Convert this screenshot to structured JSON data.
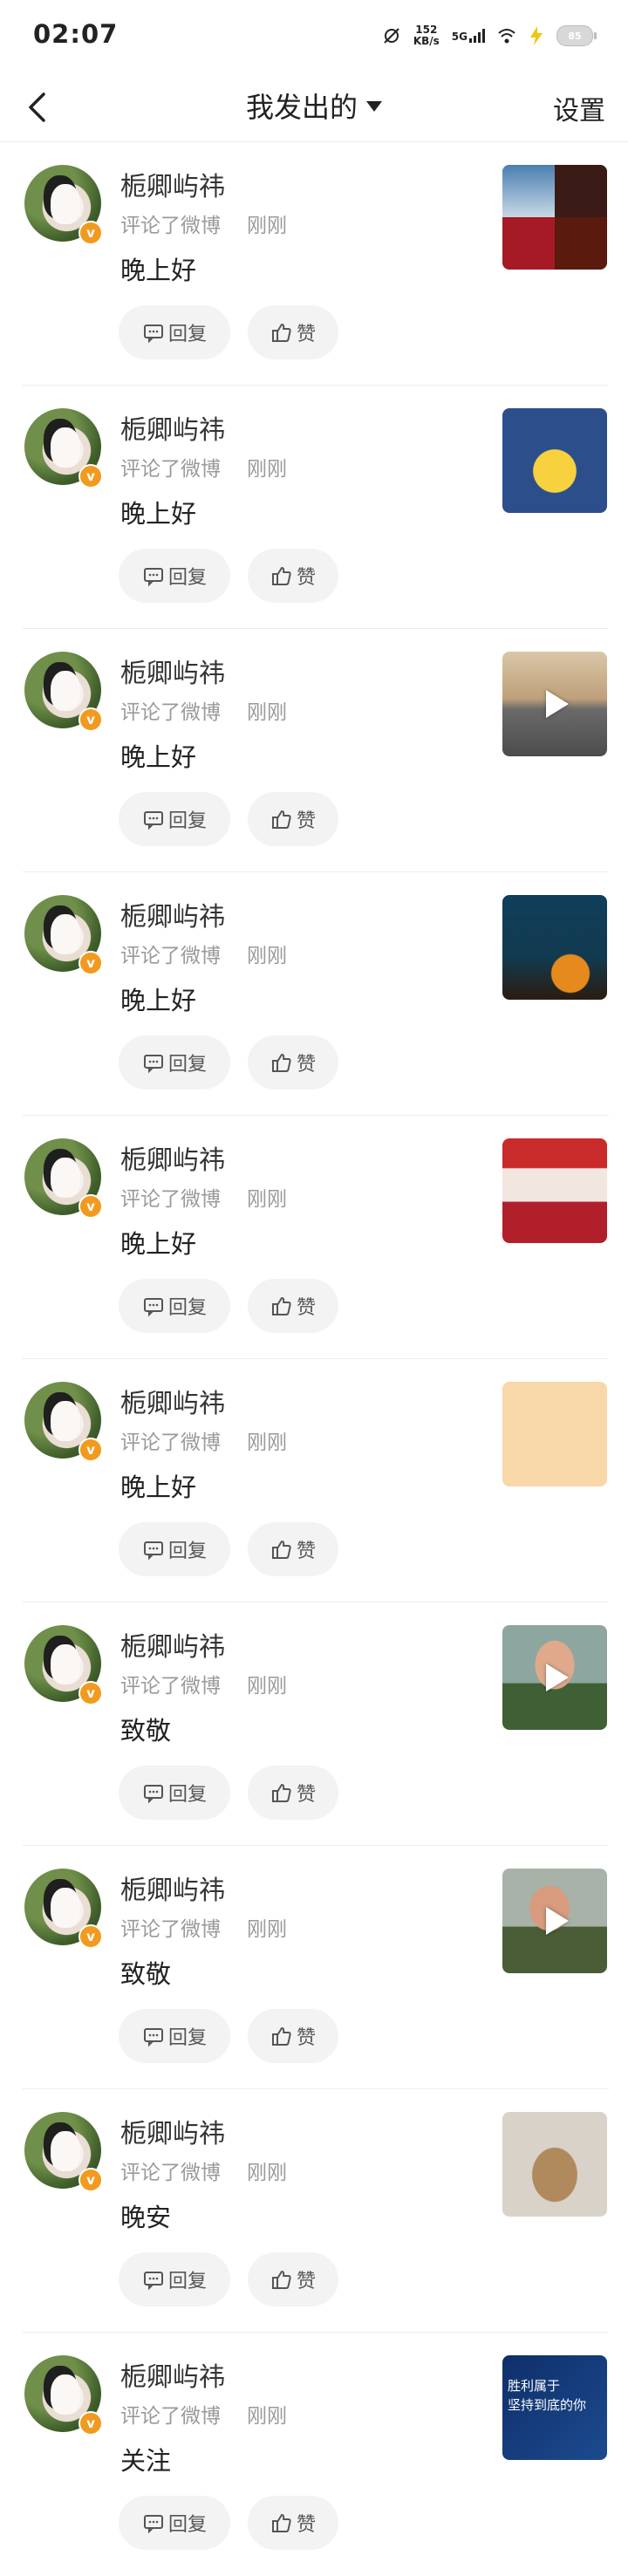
{
  "status_bar": {
    "time": "02:07",
    "speed_value": "152",
    "speed_unit": "KB/s",
    "network": "5G",
    "battery": "85"
  },
  "nav": {
    "title": "我发出的",
    "settings_label": "设置"
  },
  "feed": {
    "items": [
      {
        "username": "栀卿屿祎",
        "action": "评论了微博",
        "time": "刚刚",
        "content": "晚上好",
        "reply_label": "回复",
        "like_label": "赞"
      },
      {
        "username": "栀卿屿祎",
        "action": "评论了微博",
        "time": "刚刚",
        "content": "晚上好",
        "reply_label": "回复",
        "like_label": "赞"
      },
      {
        "username": "栀卿屿祎",
        "action": "评论了微博",
        "time": "刚刚",
        "content": "晚上好",
        "reply_label": "回复",
        "like_label": "赞"
      },
      {
        "username": "栀卿屿祎",
        "action": "评论了微博",
        "time": "刚刚",
        "content": "晚上好",
        "reply_label": "回复",
        "like_label": "赞"
      },
      {
        "username": "栀卿屿祎",
        "action": "评论了微博",
        "time": "刚刚",
        "content": "晚上好",
        "reply_label": "回复",
        "like_label": "赞"
      },
      {
        "username": "栀卿屿祎",
        "action": "评论了微博",
        "time": "刚刚",
        "content": "晚上好",
        "reply_label": "回复",
        "like_label": "赞"
      },
      {
        "username": "栀卿屿祎",
        "action": "评论了微博",
        "time": "刚刚",
        "content": "致敬",
        "reply_label": "回复",
        "like_label": "赞"
      },
      {
        "username": "栀卿屿祎",
        "action": "评论了微博",
        "time": "刚刚",
        "content": "致敬",
        "reply_label": "回复",
        "like_label": "赞"
      },
      {
        "username": "栀卿屿祎",
        "action": "评论了微博",
        "time": "刚刚",
        "content": "晚安",
        "reply_label": "回复",
        "like_label": "赞"
      },
      {
        "username": "栀卿屿祎",
        "action": "评论了微博",
        "time": "刚刚",
        "content": "关注",
        "reply_label": "回复",
        "like_label": "赞",
        "thumb_text": "胜利属于\n坚持到底的你"
      }
    ]
  },
  "colors": {
    "badge": "#f29a1f",
    "meta_text": "#9a9a9a",
    "pill_bg": "#f3f3f3"
  }
}
